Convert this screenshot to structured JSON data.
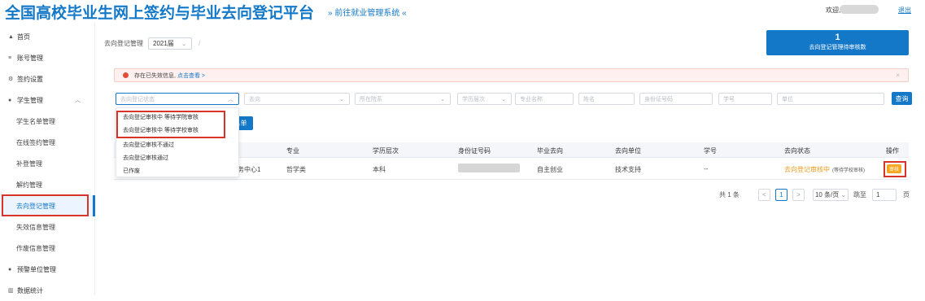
{
  "header": {
    "title": "全国高校毕业生网上签约与毕业去向登记平台",
    "jump_link": "» 前往就业管理系统 «",
    "welcome": "欢迎,",
    "logout": "退出"
  },
  "sidebar": {
    "items": [
      {
        "label": "首页",
        "icon": "home-icon"
      },
      {
        "label": "账号管理",
        "icon": "menu-icon"
      },
      {
        "label": "签约设置",
        "icon": "settings-icon"
      },
      {
        "label": "学生管理",
        "icon": "user-icon"
      },
      {
        "label": "学生名单管理"
      },
      {
        "label": "在线签约管理"
      },
      {
        "label": "补登管理"
      },
      {
        "label": "解约管理"
      },
      {
        "label": "去向登记管理"
      },
      {
        "label": "失效信息管理"
      },
      {
        "label": "作废信息管理"
      },
      {
        "label": "预警单位管理",
        "icon": "warning-icon"
      },
      {
        "label": "数据统计",
        "icon": "chart-icon"
      }
    ]
  },
  "breadcrumb": {
    "label": "去向登记管理",
    "year": "2021届",
    "separator": "/"
  },
  "stat_card": {
    "count": "1",
    "label": "去向登记管理待审核数"
  },
  "alert": {
    "text": "存在已失效信息,",
    "link": "点击查看 >",
    "close": "×"
  },
  "filters": {
    "status_placeholder": "去向登记状态",
    "destination_placeholder": "去向",
    "college_placeholder": "所在院系",
    "level_placeholder": "学历层次",
    "major_placeholder": "专业名称",
    "name_placeholder": "姓名",
    "id_placeholder": "身份证号码",
    "student_no_placeholder": "学号",
    "unit_placeholder": "单位",
    "query_button": "查询",
    "list_button": "名单"
  },
  "dropdown_options": [
    "去向登记审核中 等待学院审核",
    "去向登记审核中 等待学校审核",
    "去向登记审核不通过",
    "去向登记审核通过",
    "已作废"
  ],
  "table": {
    "headers": [
      "专业",
      "学历层次",
      "身份证号码",
      "毕业去向",
      "去向单位",
      "学号",
      "去向状态",
      "操作"
    ],
    "rows": [
      {
        "college": "服务中心1",
        "major": "哲学类",
        "level": "本科",
        "destination": "自主创业",
        "unit": "技术支持",
        "student_no": "--",
        "status": "去向登记审核中",
        "status_note": "(等待学校审核)",
        "action": "审核"
      }
    ]
  },
  "pagination": {
    "total": "共 1 条",
    "prev": "<",
    "current": "1",
    "next": ">",
    "page_size": "10 条/页",
    "jump_label": "跳至",
    "jump_value": "1",
    "page_suffix": "页"
  },
  "colors": {
    "primary": "#1478c8",
    "highlight_red": "#d9342b",
    "pending_orange": "#e89b1c"
  }
}
